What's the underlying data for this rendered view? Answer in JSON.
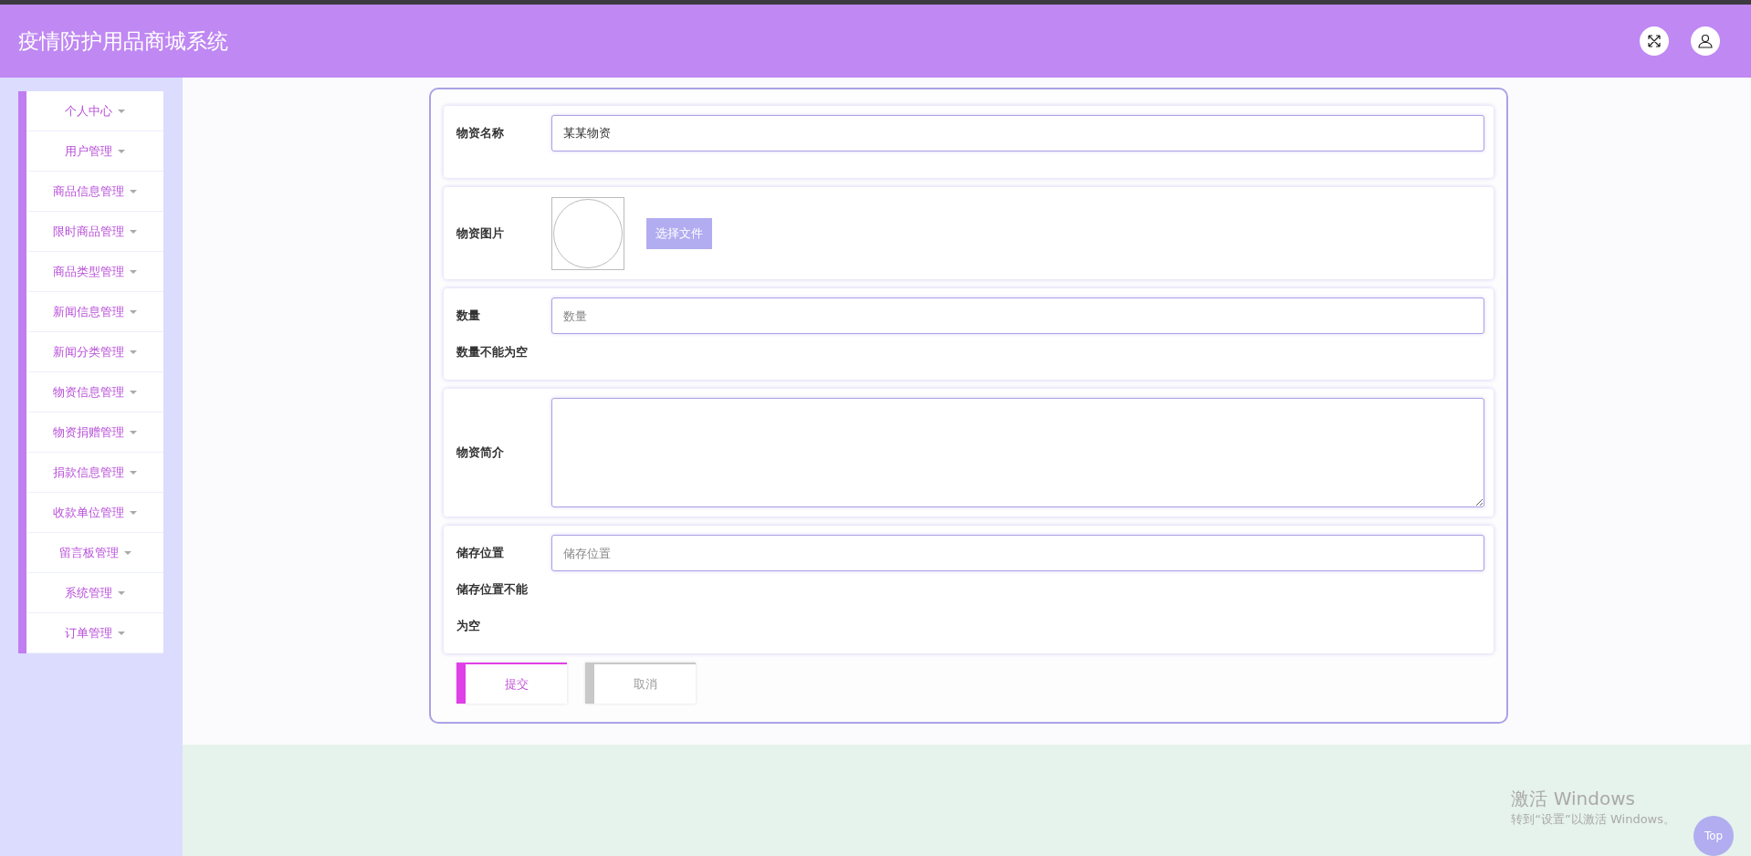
{
  "header": {
    "title": "疫情防护用品商城系统"
  },
  "sidebar": {
    "items": [
      {
        "label": "个人中心"
      },
      {
        "label": "用户管理"
      },
      {
        "label": "商品信息管理"
      },
      {
        "label": "限时商品管理"
      },
      {
        "label": "商品类型管理"
      },
      {
        "label": "新闻信息管理"
      },
      {
        "label": "新闻分类管理"
      },
      {
        "label": "物资信息管理"
      },
      {
        "label": "物资捐赠管理"
      },
      {
        "label": "捐款信息管理"
      },
      {
        "label": "收款单位管理"
      },
      {
        "label": "留言板管理"
      },
      {
        "label": "系统管理"
      },
      {
        "label": "订单管理"
      }
    ]
  },
  "form": {
    "fields": [
      {
        "kind": "input",
        "label": "物资名称",
        "value": "某某物资"
      },
      {
        "kind": "image",
        "label": "物资图片",
        "button": "选择文件"
      },
      {
        "kind": "input",
        "label": "数量",
        "placeholder": "数量",
        "error": "数量不能为空"
      },
      {
        "kind": "textarea",
        "label": "物资简介"
      },
      {
        "kind": "input",
        "label": "储存位置",
        "placeholder": "储存位置",
        "error": "储存位置不能为空"
      }
    ],
    "buttons": [
      {
        "kind": "primary",
        "label": "提交"
      },
      {
        "kind": "cancel",
        "label": "取消"
      }
    ]
  },
  "activation_notice": {
    "title": "激活 Windows",
    "text": "转到“设置”以激活 Windows。"
  },
  "top_button": "Top"
}
